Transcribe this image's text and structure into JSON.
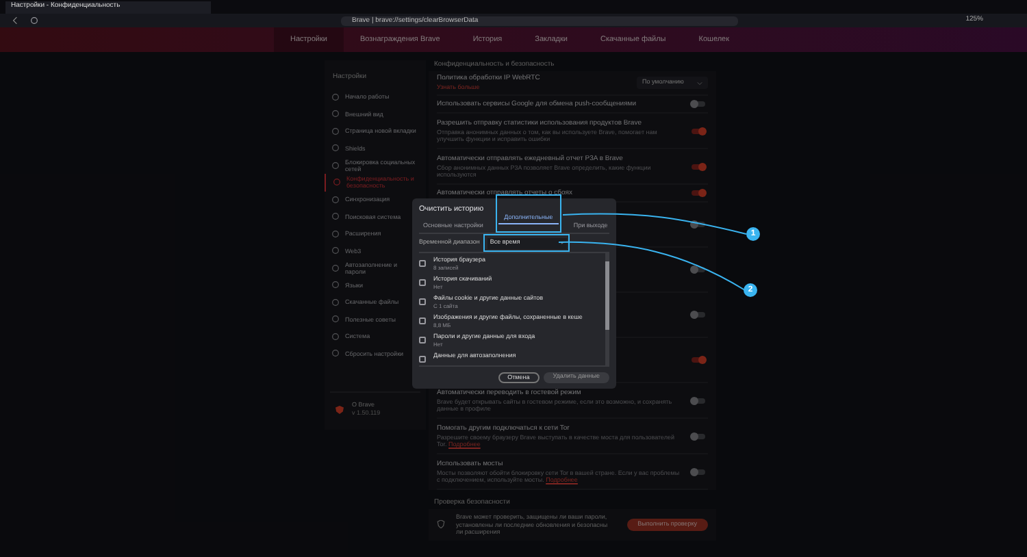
{
  "browser": {
    "tab_title": "Настройки - Конфиденциальность",
    "address": "Brave | brave://settings/clearBrowserData",
    "zoom": "125%"
  },
  "nav": [
    {
      "label": "Настройки",
      "selected": true
    },
    {
      "label": "Вознаграждения Brave",
      "selected": false
    },
    {
      "label": "История",
      "selected": false
    },
    {
      "label": "Закладки",
      "selected": false
    },
    {
      "label": "Скачанные файлы",
      "selected": false
    },
    {
      "label": "Кошелек",
      "selected": false
    }
  ],
  "sidebar": {
    "title": "Настройки",
    "items": [
      {
        "label": "Начало работы",
        "selected": false
      },
      {
        "label": "Внешний вид",
        "selected": false
      },
      {
        "label": "Страница новой вкладки",
        "selected": false
      },
      {
        "label": "Shields",
        "selected": false
      },
      {
        "label": "Блокировка социальных сетей",
        "selected": false
      },
      {
        "label": "Конфиденциальность и безопасность",
        "selected": true
      },
      {
        "label": "Синхронизация",
        "selected": false
      },
      {
        "label": "Поисковая система",
        "selected": false
      },
      {
        "label": "Расширения",
        "selected": false
      },
      {
        "label": "Web3",
        "selected": false
      },
      {
        "label": "Автозаполнение и пароли",
        "selected": false
      },
      {
        "label": "Языки",
        "selected": false
      },
      {
        "label": "Скачанные файлы",
        "selected": false
      },
      {
        "label": "Полезные советы",
        "selected": false
      },
      {
        "label": "Система",
        "selected": false
      },
      {
        "label": "Сбросить настройки",
        "selected": false
      }
    ],
    "about": "О Brave",
    "version": "v 1.50.119"
  },
  "section_title": "Конфиденциальность и безопасность",
  "rows": [
    {
      "kind": "select",
      "title": "Политика обработки IP WebRTC",
      "link": "Узнать больше",
      "value": "По умолчанию"
    },
    {
      "kind": "toggle",
      "title": "Использовать сервисы Google для обмена push-сообщениями",
      "on": false
    },
    {
      "kind": "toggle",
      "title": "Разрешить отправку статистики использования продуктов Brave",
      "description": "Отправка анонимных данных о том, как вы используете Brave, помогает нам улучшить функции и исправить ошибки",
      "on": true
    },
    {
      "kind": "toggle",
      "title": "Автоматически отправлять ежедневный отчет P3A в Brave",
      "description": "Сбор анонимных данных P3A позволяет Brave определить, какие функции используются",
      "on": true
    },
    {
      "kind": "toggle",
      "title": "Автоматически отправлять отчеты о сбоях",
      "on": true
    },
    {
      "kind": "toggle",
      "on": false
    },
    {
      "kind": "toggle",
      "on": false
    },
    {
      "kind": "toggle",
      "on": false
    },
    {
      "kind": "toggle",
      "on": true
    },
    {
      "kind": "toggle",
      "title": "Автоматически переводить в гостевой режим",
      "description": "Brave будет открывать сайты в гостевом режиме, если это возможно, и сохранять данные в профиле",
      "on": false
    },
    {
      "kind": "toggle",
      "title": "Помогать другим подключаться к сети Tor",
      "description": "Разрешите своему браузеру Brave выступать в качестве моста для пользователей Tor.",
      "link": "Подробнее",
      "on": false
    },
    {
      "kind": "toggle",
      "title": "Использовать мосты",
      "description": "Мосты позволяют обойти блокировку сети Tor в вашей стране. Если у вас проблемы с подключением, используйте мосты.",
      "link": "Подробнее",
      "on": false
    }
  ],
  "safety": {
    "title": "Проверка безопасности",
    "text": "Brave может проверить, защищены ли ваши пароли, установлены ли последние обновления и безопасны ли расширения",
    "button": "Выполнить проверку"
  },
  "dialog": {
    "title": "Очистить историю",
    "tabs": [
      {
        "label": "Основные настройки",
        "selected": false
      },
      {
        "label": "Дополнительные",
        "selected": true
      },
      {
        "label": "При выходе",
        "selected": false
      }
    ],
    "range_label": "Временной диапазон",
    "range_value": "Все время",
    "items": [
      {
        "title": "История браузера",
        "detail": "8 записей",
        "checked": false
      },
      {
        "title": "История скачиваний",
        "detail": "Нет",
        "checked": false
      },
      {
        "title": "Файлы cookie и другие данные сайтов",
        "detail": "С 1 сайта",
        "checked": false
      },
      {
        "title": "Изображения и другие файлы, сохраненные в кеше",
        "detail": "8,8 МБ",
        "checked": false
      },
      {
        "title": "Пароли и другие данные для входа",
        "detail": "Нет",
        "checked": false
      },
      {
        "title": "Данные для автозаполнения",
        "checked": false
      }
    ],
    "cancel": "Отмена",
    "confirm": "Удалить данные"
  },
  "callouts": [
    "1",
    "2"
  ]
}
